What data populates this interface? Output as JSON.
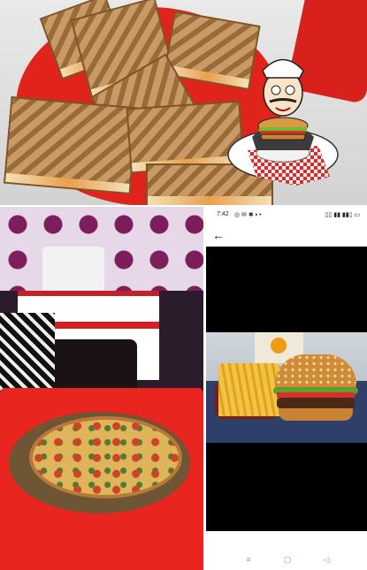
{
  "phone": {
    "status_time": "7:42",
    "status_icons": "◎ ✉ ✱ ▪ •",
    "status_right": "▯▯ ▮▮ ▮▮▯ ▭",
    "back_glyph": "←",
    "nav_recent": "≡",
    "nav_home": "▢",
    "nav_back": "◁"
  },
  "colors": {
    "plate_red": "#e0231b",
    "table_red": "#e8261f",
    "tray_blue": "#2e3f69"
  }
}
